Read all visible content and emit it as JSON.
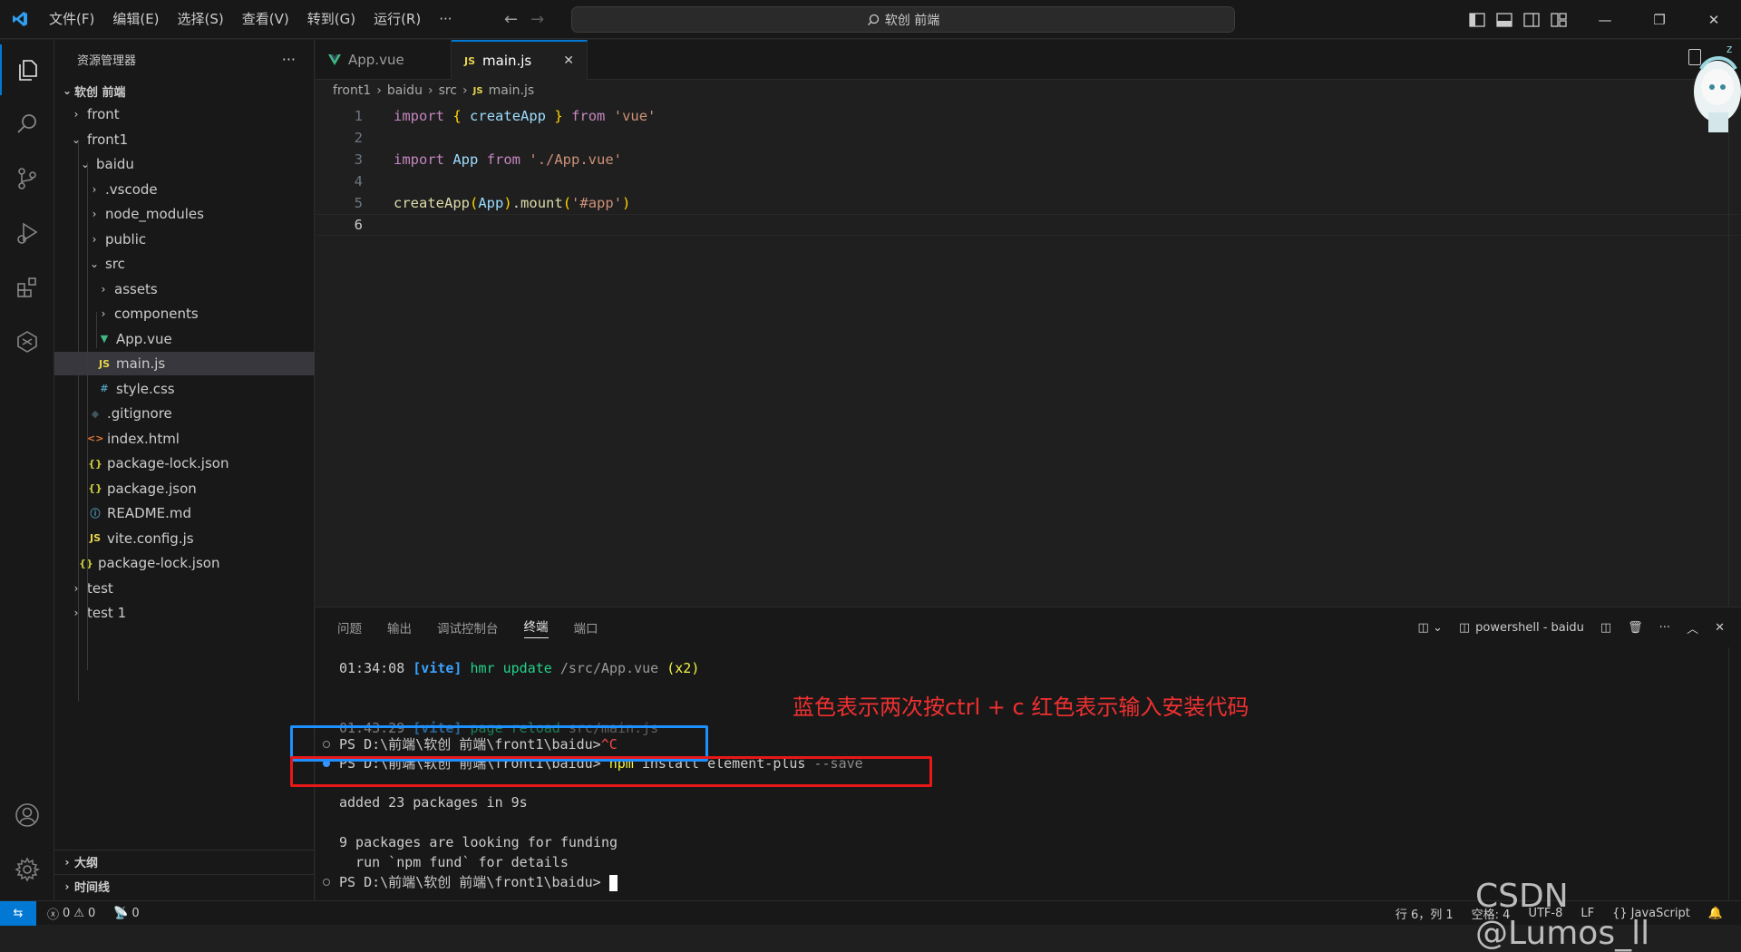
{
  "titlebar": {
    "menus": [
      "文件(F)",
      "编辑(E)",
      "选择(S)",
      "查看(V)",
      "转到(G)",
      "运行(R)",
      "···"
    ],
    "search_text": "软创 前端"
  },
  "sidebar": {
    "title": "资源管理器",
    "more": "···",
    "root": "软创 前端",
    "tree": [
      {
        "label": "front",
        "icon": "folder-closed",
        "depth": 1
      },
      {
        "label": "front1",
        "icon": "folder-open",
        "depth": 1
      },
      {
        "label": "baidu",
        "icon": "folder-open",
        "depth": 2
      },
      {
        "label": ".vscode",
        "icon": "folder-closed",
        "depth": 3
      },
      {
        "label": "node_modules",
        "icon": "folder-closed",
        "depth": 3
      },
      {
        "label": "public",
        "icon": "folder-closed",
        "depth": 3
      },
      {
        "label": "src",
        "icon": "folder-open",
        "depth": 3
      },
      {
        "label": "assets",
        "icon": "folder-closed",
        "depth": 4
      },
      {
        "label": "components",
        "icon": "folder-closed",
        "depth": 4
      },
      {
        "label": "App.vue",
        "icon": "vue-file",
        "depth": 4
      },
      {
        "label": "main.js",
        "icon": "js-file",
        "depth": 4,
        "selected": true
      },
      {
        "label": "style.css",
        "icon": "css-file",
        "depth": 4
      },
      {
        "label": ".gitignore",
        "icon": "git-file",
        "depth": 3
      },
      {
        "label": "index.html",
        "icon": "html-file",
        "depth": 3
      },
      {
        "label": "package-lock.json",
        "icon": "json-file",
        "depth": 3
      },
      {
        "label": "package.json",
        "icon": "json-file",
        "depth": 3
      },
      {
        "label": "README.md",
        "icon": "info-file",
        "depth": 3
      },
      {
        "label": "vite.config.js",
        "icon": "js-file",
        "depth": 3
      },
      {
        "label": "package-lock.json",
        "icon": "json-file",
        "depth": 2
      },
      {
        "label": "test",
        "icon": "folder-closed",
        "depth": 1
      },
      {
        "label": "test 1",
        "icon": "folder-closed",
        "depth": 1
      }
    ],
    "outline_label": "大纲",
    "timeline_label": "时间线"
  },
  "editor": {
    "tabs": [
      {
        "label": "App.vue",
        "icon": "vue-file",
        "active": false
      },
      {
        "label": "main.js",
        "icon": "js-file",
        "active": true,
        "close": "✕"
      }
    ],
    "breadcrumb": [
      "front1",
      "baidu",
      "src",
      "main.js"
    ],
    "line_numbers": [
      "1",
      "2",
      "3",
      "4",
      "5",
      "6"
    ],
    "current_line": "6"
  },
  "panel": {
    "tabs": [
      "问题",
      "输出",
      "调试控制台",
      "终端",
      "端口"
    ],
    "active_tab": "终端",
    "terminal_name": "powershell - baidu",
    "lines": {
      "l1_time": "01:34:08",
      "l1_tag": "[vite]",
      "l1_msg": "hmr update",
      "l1_path": "/src/App.vue",
      "l1_count": "(x2)",
      "l2_time": "01:43:29",
      "l2_tag": "[vite]",
      "l2_msg": "page reload",
      "l2_path": "src/main.js",
      "l3_prompt": "PS D:\\前端\\软创 前端\\front1\\baidu>",
      "l3_cmd": "^C",
      "l4_prompt": "PS D:\\前端\\软创 前端\\front1\\baidu>",
      "l4_cmd": "npm",
      "l4_args": "install element-plus",
      "l4_flag": "--save",
      "l5": "added 23 packages in 9s",
      "l6": "9 packages are looking for funding",
      "l7": "  run `npm fund` for details",
      "l8_prompt": "PS D:\\前端\\软创 前端\\front1\\baidu>"
    }
  },
  "annotation": "蓝色表示两次按ctrl + c  红色表示输入安装代码",
  "statusbar": {
    "errors": "0",
    "warnings": "0",
    "ports": "0",
    "position": "行 6，列 1",
    "spaces": "空格: 4",
    "encoding": "UTF-8",
    "eol": "LF",
    "language": "JavaScript"
  },
  "watermark": "CSDN @Lumos_ll",
  "colors": {
    "accent": "#0078d4",
    "annotation_red": "#e81818",
    "annotation_blue": "#1e90ff"
  }
}
